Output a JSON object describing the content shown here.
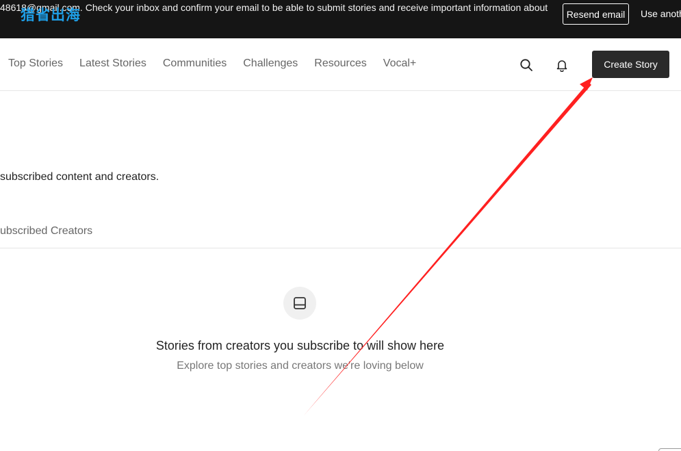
{
  "banner": {
    "message": "48618@gmail.com. Check your inbox and confirm your email to be able to submit stories and receive important information about",
    "watermark": "猎省出海",
    "resend_label": "Resend email",
    "use_another_label": "Use anoth"
  },
  "nav": {
    "links": [
      "Top Stories",
      "Latest Stories",
      "Communities",
      "Challenges",
      "Resources",
      "Vocal+"
    ],
    "search_icon": "search-icon",
    "bell_icon": "bell-icon",
    "create_label": "Create Story"
  },
  "page": {
    "subtitle": "subscribed content and creators.",
    "tab_label": "ubscribed Creators"
  },
  "empty_state": {
    "icon": "book-icon",
    "title": "Stories from creators you subscribe to will show here",
    "subtitle": "Explore top stories and creators we're loving below"
  },
  "annotation": {
    "arrow_color": "#ff2020"
  }
}
